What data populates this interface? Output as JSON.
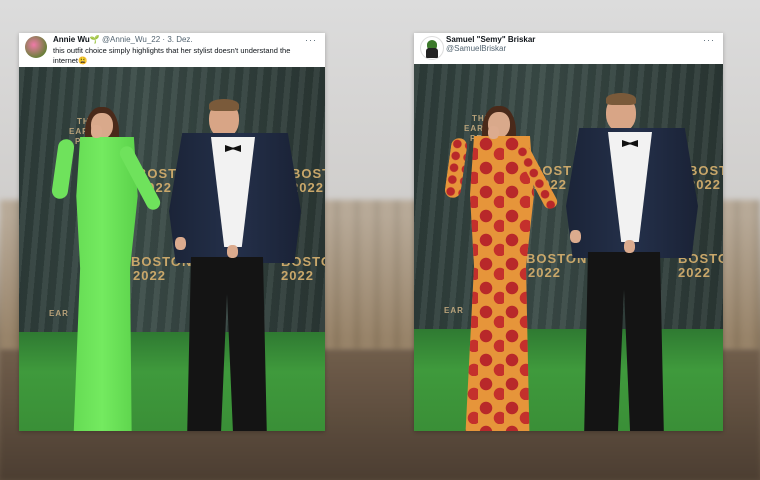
{
  "left_tweet": {
    "author_name": "Annie Wu🌱",
    "author_handle": "@Annie_Wu_22",
    "separator": "·",
    "date": "3. Dez.",
    "more_label": "···",
    "text": "this outfit choice simply highlights that her stylist doesn't understand the internet😩",
    "photo_backdrop_text": [
      "THE",
      "EARTHS",
      "PR",
      "BOSTON",
      "2022",
      "BOSTON",
      "2022",
      "BOSTON",
      "2022",
      "BOSTON",
      "2022",
      "EAR"
    ]
  },
  "right_tweet": {
    "author_name": "Samuel \"Semy\" Briskar",
    "author_handle": "@SamuelBriskar",
    "more_label": "···",
    "photo_backdrop_text": [
      "THE",
      "EARTHS",
      "PR",
      "BOSTON",
      "2022",
      "BOSTON",
      "2022",
      "BOSTON",
      "2022",
      "BOSTON",
      "2022",
      "EAR"
    ]
  },
  "colors": {
    "green_dress": "#6fe25c",
    "pizza_base": "#e6953a",
    "pepperoni": "#b8282a",
    "backdrop": "#2e3d3a",
    "floor": "#3f9a3c"
  }
}
